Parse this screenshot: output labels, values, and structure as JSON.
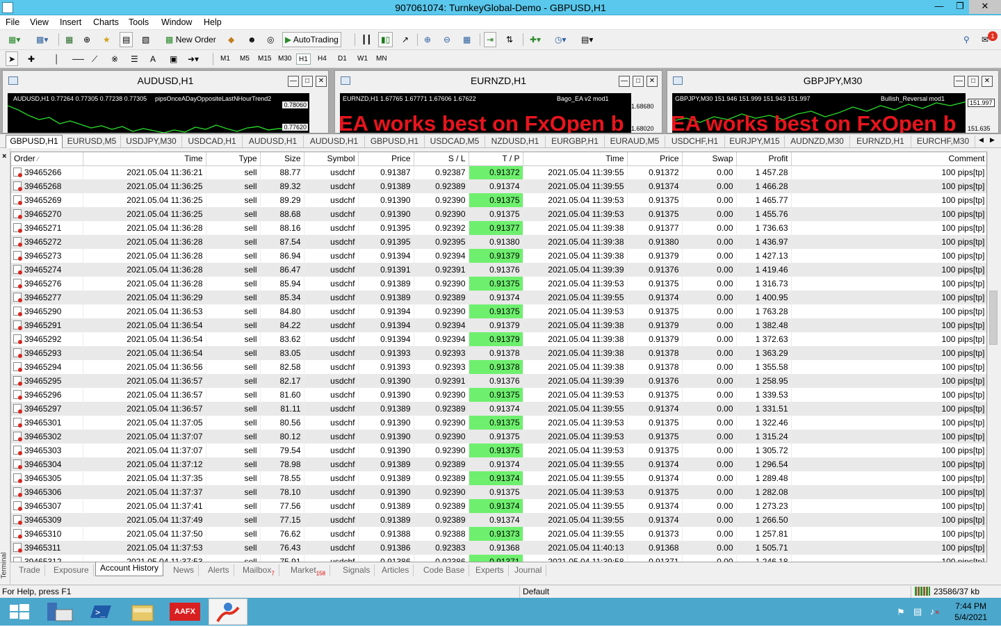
{
  "window": {
    "title": "907061074: TurnkeyGlobal-Demo - GBPUSD,H1",
    "min_icon": "minimize-icon",
    "restore_icon": "restore-icon",
    "close_icon": "close-icon"
  },
  "menu": [
    "File",
    "View",
    "Insert",
    "Charts",
    "Tools",
    "Window",
    "Help"
  ],
  "toolbar": {
    "new_order": "New Order",
    "autotrading": "AutoTrading",
    "alerts_count": "1"
  },
  "timeframes": [
    "M1",
    "M5",
    "M15",
    "M30",
    "H1",
    "H4",
    "D1",
    "W1",
    "MN"
  ],
  "timeframe_selected": "H1",
  "charts": [
    {
      "title": "AUDUSD,H1",
      "info": "AUDUSD,H1  0.77264 0.77305 0.77238 0.77305",
      "ea": "pipsOnceADayOppositeLastNHourTrend2",
      "price_top": "0.78060",
      "price_bottom": "0.77620",
      "banner": ""
    },
    {
      "title": "EURNZD,H1",
      "info": "EURNZD,H1  1.67765 1.67771 1.67606 1.67622",
      "ea": "Bago_EA v2 mod1",
      "price_top": "1.68680",
      "price_bottom": "1.68020",
      "banner": "EA works best on FxOpen b"
    },
    {
      "title": "GBPJPY,M30",
      "info": "GBPJPY,M30  151.946 151.999 151.943 151.997",
      "ea": "Bullish_Reversal mod1",
      "price_top": "151.997",
      "price_bottom": "151.635",
      "banner": "EA works best on FxOpen b"
    }
  ],
  "symbol_tabs": [
    "GBPUSD,H1",
    "EURUSD,M5",
    "USDJPY,M30",
    "USDCAD,H1",
    "AUDUSD,H1",
    "AUDUSD,H1",
    "GBPUSD,H1",
    "USDCAD,M5",
    "NZDUSD,H1",
    "EURGBP,H1",
    "EURAUD,M5",
    "USDCHF,H1",
    "EURJPY,M15",
    "AUDNZD,M30",
    "EURNZD,H1",
    "EURCHF,M30"
  ],
  "terminal_label": "Terminal",
  "columns": [
    "Order",
    "Time",
    "Type",
    "Size",
    "Symbol",
    "Price",
    "S / L",
    "T / P",
    "Time",
    "Price",
    "Swap",
    "Profit",
    "Comment"
  ],
  "rows": [
    [
      "39465266",
      "2021.05.04 11:36:21",
      "sell",
      "88.77",
      "usdchf",
      "0.91387",
      "0.92387",
      "0.91372",
      "2021.05.04 11:39:55",
      "0.91372",
      "0.00",
      "1 457.28",
      "100 pips[tp]"
    ],
    [
      "39465268",
      "2021.05.04 11:36:25",
      "sell",
      "89.32",
      "usdchf",
      "0.91389",
      "0.92389",
      "0.91374",
      "2021.05.04 11:39:55",
      "0.91374",
      "0.00",
      "1 466.28",
      "100 pips[tp]"
    ],
    [
      "39465269",
      "2021.05.04 11:36:25",
      "sell",
      "89.29",
      "usdchf",
      "0.91390",
      "0.92390",
      "0.91375",
      "2021.05.04 11:39:53",
      "0.91375",
      "0.00",
      "1 465.77",
      "100 pips[tp]"
    ],
    [
      "39465270",
      "2021.05.04 11:36:25",
      "sell",
      "88.68",
      "usdchf",
      "0.91390",
      "0.92390",
      "0.91375",
      "2021.05.04 11:39:53",
      "0.91375",
      "0.00",
      "1 455.76",
      "100 pips[tp]"
    ],
    [
      "39465271",
      "2021.05.04 11:36:28",
      "sell",
      "88.16",
      "usdchf",
      "0.91395",
      "0.92392",
      "0.91377",
      "2021.05.04 11:39:38",
      "0.91377",
      "0.00",
      "1 736.63",
      "100 pips[tp]"
    ],
    [
      "39465272",
      "2021.05.04 11:36:28",
      "sell",
      "87.54",
      "usdchf",
      "0.91395",
      "0.92395",
      "0.91380",
      "2021.05.04 11:39:38",
      "0.91380",
      "0.00",
      "1 436.97",
      "100 pips[tp]"
    ],
    [
      "39465273",
      "2021.05.04 11:36:28",
      "sell",
      "86.94",
      "usdchf",
      "0.91394",
      "0.92394",
      "0.91379",
      "2021.05.04 11:39:38",
      "0.91379",
      "0.00",
      "1 427.13",
      "100 pips[tp]"
    ],
    [
      "39465274",
      "2021.05.04 11:36:28",
      "sell",
      "86.47",
      "usdchf",
      "0.91391",
      "0.92391",
      "0.91376",
      "2021.05.04 11:39:39",
      "0.91376",
      "0.00",
      "1 419.46",
      "100 pips[tp]"
    ],
    [
      "39465276",
      "2021.05.04 11:36:28",
      "sell",
      "85.94",
      "usdchf",
      "0.91389",
      "0.92390",
      "0.91375",
      "2021.05.04 11:39:53",
      "0.91375",
      "0.00",
      "1 316.73",
      "100 pips[tp]"
    ],
    [
      "39465277",
      "2021.05.04 11:36:29",
      "sell",
      "85.34",
      "usdchf",
      "0.91389",
      "0.92389",
      "0.91374",
      "2021.05.04 11:39:55",
      "0.91374",
      "0.00",
      "1 400.95",
      "100 pips[tp]"
    ],
    [
      "39465290",
      "2021.05.04 11:36:53",
      "sell",
      "84.80",
      "usdchf",
      "0.91394",
      "0.92390",
      "0.91375",
      "2021.05.04 11:39:53",
      "0.91375",
      "0.00",
      "1 763.28",
      "100 pips[tp]"
    ],
    [
      "39465291",
      "2021.05.04 11:36:54",
      "sell",
      "84.22",
      "usdchf",
      "0.91394",
      "0.92394",
      "0.91379",
      "2021.05.04 11:39:38",
      "0.91379",
      "0.00",
      "1 382.48",
      "100 pips[tp]"
    ],
    [
      "39465292",
      "2021.05.04 11:36:54",
      "sell",
      "83.62",
      "usdchf",
      "0.91394",
      "0.92394",
      "0.91379",
      "2021.05.04 11:39:38",
      "0.91379",
      "0.00",
      "1 372.63",
      "100 pips[tp]"
    ],
    [
      "39465293",
      "2021.05.04 11:36:54",
      "sell",
      "83.05",
      "usdchf",
      "0.91393",
      "0.92393",
      "0.91378",
      "2021.05.04 11:39:38",
      "0.91378",
      "0.00",
      "1 363.29",
      "100 pips[tp]"
    ],
    [
      "39465294",
      "2021.05.04 11:36:56",
      "sell",
      "82.58",
      "usdchf",
      "0.91393",
      "0.92393",
      "0.91378",
      "2021.05.04 11:39:38",
      "0.91378",
      "0.00",
      "1 355.58",
      "100 pips[tp]"
    ],
    [
      "39465295",
      "2021.05.04 11:36:57",
      "sell",
      "82.17",
      "usdchf",
      "0.91390",
      "0.92391",
      "0.91376",
      "2021.05.04 11:39:39",
      "0.91376",
      "0.00",
      "1 258.95",
      "100 pips[tp]"
    ],
    [
      "39465296",
      "2021.05.04 11:36:57",
      "sell",
      "81.60",
      "usdchf",
      "0.91390",
      "0.92390",
      "0.91375",
      "2021.05.04 11:39:53",
      "0.91375",
      "0.00",
      "1 339.53",
      "100 pips[tp]"
    ],
    [
      "39465297",
      "2021.05.04 11:36:57",
      "sell",
      "81.11",
      "usdchf",
      "0.91389",
      "0.92389",
      "0.91374",
      "2021.05.04 11:39:55",
      "0.91374",
      "0.00",
      "1 331.51",
      "100 pips[tp]"
    ],
    [
      "39465301",
      "2021.05.04 11:37:05",
      "sell",
      "80.56",
      "usdchf",
      "0.91390",
      "0.92390",
      "0.91375",
      "2021.05.04 11:39:53",
      "0.91375",
      "0.00",
      "1 322.46",
      "100 pips[tp]"
    ],
    [
      "39465302",
      "2021.05.04 11:37:07",
      "sell",
      "80.12",
      "usdchf",
      "0.91390",
      "0.92390",
      "0.91375",
      "2021.05.04 11:39:53",
      "0.91375",
      "0.00",
      "1 315.24",
      "100 pips[tp]"
    ],
    [
      "39465303",
      "2021.05.04 11:37:07",
      "sell",
      "79.54",
      "usdchf",
      "0.91390",
      "0.92390",
      "0.91375",
      "2021.05.04 11:39:53",
      "0.91375",
      "0.00",
      "1 305.72",
      "100 pips[tp]"
    ],
    [
      "39465304",
      "2021.05.04 11:37:12",
      "sell",
      "78.98",
      "usdchf",
      "0.91389",
      "0.92389",
      "0.91374",
      "2021.05.04 11:39:55",
      "0.91374",
      "0.00",
      "1 296.54",
      "100 pips[tp]"
    ],
    [
      "39465305",
      "2021.05.04 11:37:35",
      "sell",
      "78.55",
      "usdchf",
      "0.91389",
      "0.92389",
      "0.91374",
      "2021.05.04 11:39:55",
      "0.91374",
      "0.00",
      "1 289.48",
      "100 pips[tp]"
    ],
    [
      "39465306",
      "2021.05.04 11:37:37",
      "sell",
      "78.10",
      "usdchf",
      "0.91390",
      "0.92390",
      "0.91375",
      "2021.05.04 11:39:53",
      "0.91375",
      "0.00",
      "1 282.08",
      "100 pips[tp]"
    ],
    [
      "39465307",
      "2021.05.04 11:37:41",
      "sell",
      "77.56",
      "usdchf",
      "0.91389",
      "0.92389",
      "0.91374",
      "2021.05.04 11:39:55",
      "0.91374",
      "0.00",
      "1 273.23",
      "100 pips[tp]"
    ],
    [
      "39465309",
      "2021.05.04 11:37:49",
      "sell",
      "77.15",
      "usdchf",
      "0.91389",
      "0.92389",
      "0.91374",
      "2021.05.04 11:39:55",
      "0.91374",
      "0.00",
      "1 266.50",
      "100 pips[tp]"
    ],
    [
      "39465310",
      "2021.05.04 11:37:50",
      "sell",
      "76.62",
      "usdchf",
      "0.91388",
      "0.92388",
      "0.91373",
      "2021.05.04 11:39:55",
      "0.91373",
      "0.00",
      "1 257.81",
      "100 pips[tp]"
    ],
    [
      "39465311",
      "2021.05.04 11:37:53",
      "sell",
      "76.43",
      "usdchf",
      "0.91386",
      "0.92383",
      "0.91368",
      "2021.05.04 11:40:13",
      "0.91368",
      "0.00",
      "1 505.71",
      "100 pips[tp]"
    ],
    [
      "39465312",
      "2021.05.04 11:37:53",
      "sell",
      "75.91",
      "usdchf",
      "0.91386",
      "0.92386",
      "0.91371",
      "2021.05.04 11:39:58",
      "0.91371",
      "0.00",
      "1 246.18",
      "100 pips[tp]"
    ]
  ],
  "bottom_tabs": [
    {
      "label": "Trade",
      "badge": ""
    },
    {
      "label": "Exposure",
      "badge": ""
    },
    {
      "label": "Account History",
      "badge": ""
    },
    {
      "label": "News",
      "badge": ""
    },
    {
      "label": "Alerts",
      "badge": ""
    },
    {
      "label": "Mailbox",
      "badge": "7"
    },
    {
      "label": "Market",
      "badge": "158"
    },
    {
      "label": "Signals",
      "badge": ""
    },
    {
      "label": "Articles",
      "badge": ""
    },
    {
      "label": "Code Base",
      "badge": ""
    },
    {
      "label": "Experts",
      "badge": ""
    },
    {
      "label": "Journal",
      "badge": ""
    }
  ],
  "bottom_tab_active": "Account History",
  "status": {
    "help": "For Help, press F1",
    "profile": "Default",
    "traffic": "23586/37 kb"
  },
  "taskbar": {
    "aafx_label": "AAFX",
    "time": "7:44 PM",
    "date": "5/4/2021"
  },
  "colors": {
    "titlebar": "#5ac8ec",
    "tp_highlight": "#6ef06e",
    "banner_red": "#e8141d",
    "taskbar": "#4ca7cc"
  }
}
